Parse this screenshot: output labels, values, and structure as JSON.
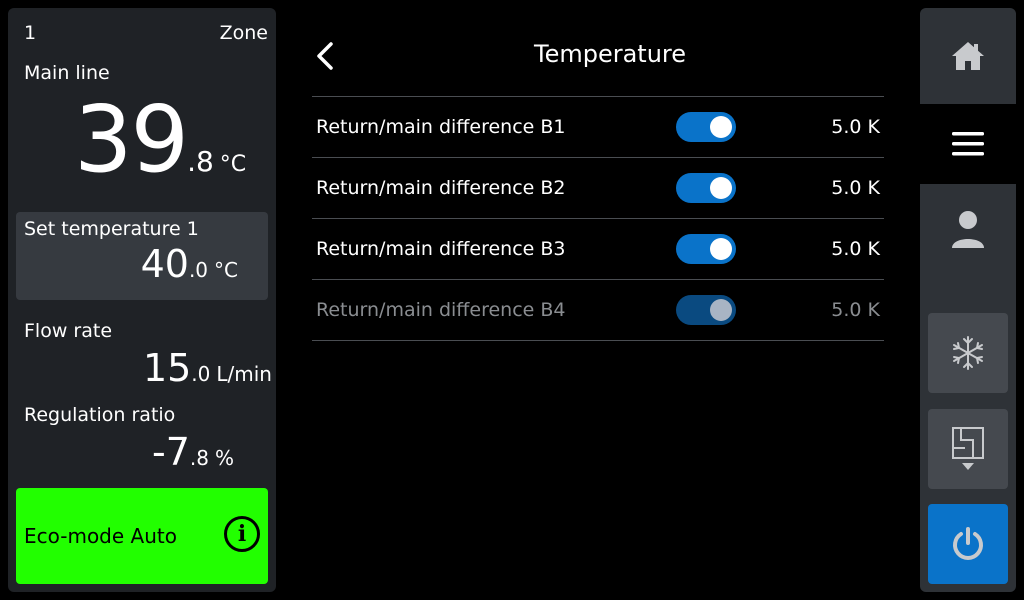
{
  "zone": {
    "number": "1",
    "label": "Zone"
  },
  "main_line": {
    "label": "Main line",
    "integer": "39",
    "decimal": ".8",
    "unit": "°C"
  },
  "set_temperature": {
    "label": "Set temperature 1",
    "integer": "40",
    "decimal": ".0",
    "unit": "°C"
  },
  "flow_rate": {
    "label": "Flow rate",
    "integer": "15",
    "decimal": ".0",
    "unit": "L/min"
  },
  "regulation_ratio": {
    "label": "Regulation ratio",
    "integer": "-7",
    "decimal": ".8",
    "unit": "%"
  },
  "eco_mode": {
    "label": "Eco-mode Auto",
    "info_glyph": "i",
    "color": "#22ff00"
  },
  "page": {
    "title": "Temperature"
  },
  "settings": [
    {
      "label": "Return/main difference B1",
      "value": "5.0  K",
      "toggle_on": true,
      "enabled": true
    },
    {
      "label": "Return/main difference B2",
      "value": "5.0  K",
      "toggle_on": true,
      "enabled": true
    },
    {
      "label": "Return/main difference B3",
      "value": "5.0  K",
      "toggle_on": true,
      "enabled": true
    },
    {
      "label": "Return/main difference B4",
      "value": "5.0  K",
      "toggle_on": true,
      "enabled": false
    }
  ],
  "nav": [
    {
      "icon": "home-icon",
      "active": false
    },
    {
      "icon": "menu-icon",
      "active": true
    },
    {
      "icon": "user-icon",
      "active": false
    },
    {
      "icon": "snowflake-icon",
      "active": false
    },
    {
      "icon": "door-icon",
      "active": false
    },
    {
      "icon": "power-icon",
      "active": false
    }
  ],
  "colors": {
    "accent": "#0a73c9",
    "panel": "#1f2226",
    "eco": "#22ff00"
  }
}
